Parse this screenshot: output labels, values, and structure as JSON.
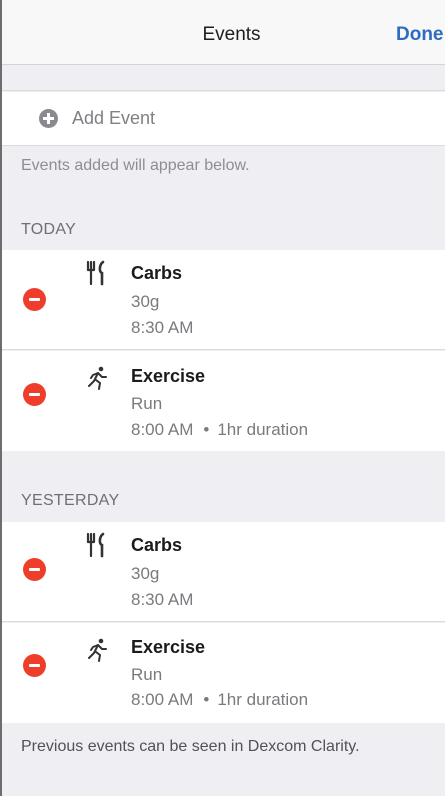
{
  "navbar": {
    "title": "Events",
    "done_label": "Done"
  },
  "add_event": {
    "label": "Add Event",
    "icon": "plus-circle-icon"
  },
  "hint": "Events added will appear below.",
  "sections": [
    {
      "header": "TODAY",
      "events": [
        {
          "type": "Carbs",
          "icon": "fork-knife-icon",
          "detail": "30g",
          "time": "8:30 AM",
          "duration": ""
        },
        {
          "type": "Exercise",
          "icon": "runner-icon",
          "detail": "Run",
          "time": "8:00 AM",
          "duration": "1hr duration"
        }
      ]
    },
    {
      "header": "YESTERDAY",
      "events": [
        {
          "type": "Carbs",
          "icon": "fork-knife-icon",
          "detail": "30g",
          "time": "8:30 AM",
          "duration": ""
        },
        {
          "type": "Exercise",
          "icon": "runner-icon",
          "detail": "Run",
          "time": "8:00 AM",
          "duration": "1hr duration"
        }
      ]
    }
  ],
  "separator": "•",
  "footer": "Previous events can be seen in Dexcom Clarity.",
  "colors": {
    "accent": "#2d6cc0",
    "delete": "#ee3e2b",
    "background": "#efeff3"
  }
}
